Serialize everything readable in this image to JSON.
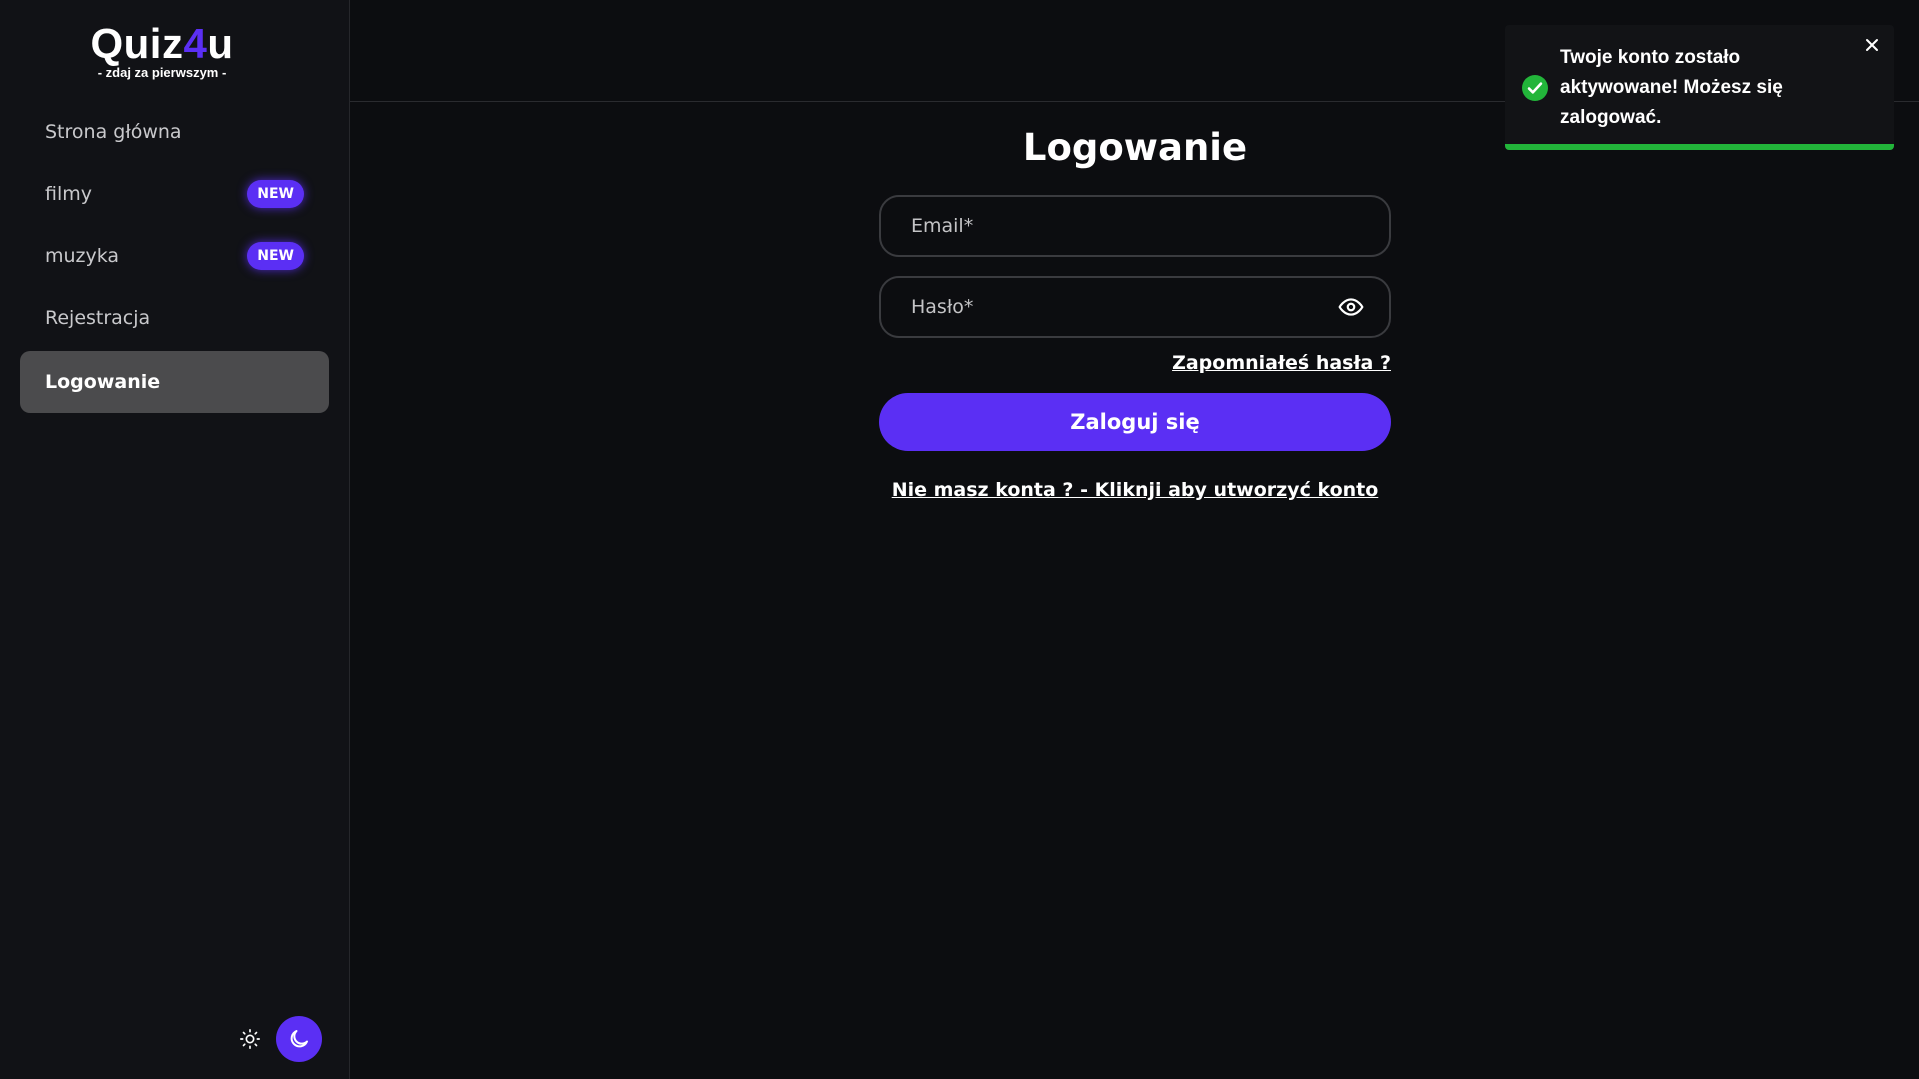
{
  "brand": {
    "title_part1": "Quiz",
    "title_accent": "4",
    "title_part2": "u",
    "subtitle": "- zdaj za pierwszym -"
  },
  "sidebar": {
    "items": [
      {
        "label": "Strona główna",
        "badge": null,
        "active": false
      },
      {
        "label": "filmy",
        "badge": "NEW",
        "active": false
      },
      {
        "label": "muzyka",
        "badge": "NEW",
        "active": false
      },
      {
        "label": "Rejestracja",
        "badge": null,
        "active": false
      },
      {
        "label": "Logowanie",
        "badge": null,
        "active": true
      }
    ],
    "theme": {
      "light_icon": "sun-icon",
      "dark_icon": "moon-icon",
      "selected": "dark"
    }
  },
  "login": {
    "title": "Logowanie",
    "email_placeholder": "Email*",
    "email_value": "",
    "password_placeholder": "Hasło*",
    "password_value": "",
    "forgot_link": "Zapomniałeś hasła ?",
    "submit_label": "Zaloguj się",
    "register_link": "Nie masz konta ? - Kliknji aby utworzyć konto"
  },
  "toast": {
    "message": "Twoje konto zostało aktywowane! Możesz się zalogować.",
    "status": "success",
    "progress": 1.0,
    "icon": "check-circle-icon"
  },
  "colors": {
    "accent": "#5b2ff4",
    "success": "#22b53a",
    "background": "#0c0d10",
    "sidebar": "#111216"
  }
}
